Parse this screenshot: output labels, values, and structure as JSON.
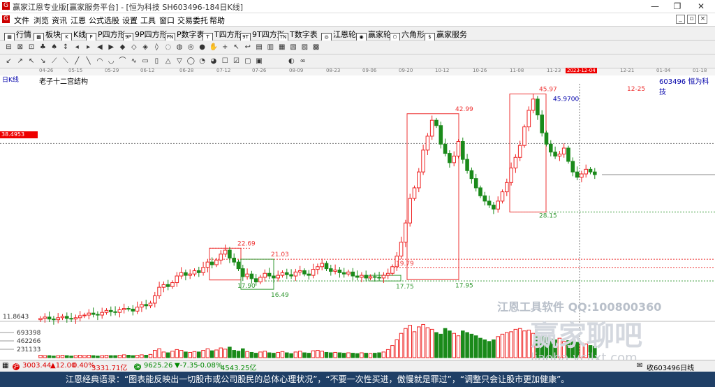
{
  "window": {
    "title": "赢家江恩专业版[赢家服务平台] - [恒为科技  SH603496-184日K线]",
    "min_glyph": "—",
    "max_glyph": "❐",
    "close_glyph": "✕"
  },
  "menu": [
    "文件",
    "浏览",
    "资讯",
    "江恩",
    "公式选股",
    "设置",
    "工具",
    "窗口",
    "交易委托",
    "帮助"
  ],
  "toolbar1": [
    {
      "label": "行情",
      "icon": "grid-icon",
      "glyph": "▦"
    },
    {
      "label": "板块",
      "icon": "sector-icon",
      "glyph": "▩"
    },
    {
      "label": "K线",
      "icon": "kline-icon",
      "glyph": "K"
    },
    {
      "label": "P四方形",
      "icon": "p-square-icon",
      "glyph": "P"
    },
    {
      "label": "9P四方形",
      "icon": "9p-square-icon",
      "glyph": "9P"
    },
    {
      "label": "P数字表",
      "icon": "p-number-icon",
      "glyph": "PN"
    },
    {
      "label": "T四方形",
      "icon": "t-square-icon",
      "glyph": "T"
    },
    {
      "label": "9T四方形",
      "icon": "9t-square-icon",
      "glyph": "9T"
    },
    {
      "label": "T数字表",
      "icon": "t-number-icon",
      "glyph": "TN"
    },
    {
      "label": "江恩轮",
      "icon": "gann-wheel-icon",
      "glyph": "◎"
    },
    {
      "label": "赢家轮",
      "icon": "winner-wheel-icon",
      "glyph": "◉"
    },
    {
      "label": "六角形",
      "icon": "hexagon-icon",
      "glyph": "⬡"
    },
    {
      "label": "赢家服务",
      "icon": "service-icon",
      "glyph": "$"
    }
  ],
  "toolbar2_icons": [
    "⊟",
    "⊠",
    "⊡",
    "♣",
    "♠",
    "↕",
    "◂",
    "▸",
    "◀",
    "▶",
    "◆",
    "◇",
    "◈",
    "◊",
    "◌",
    "◍",
    "◎",
    "●",
    "✋",
    "+",
    "↖",
    "↩",
    "▤",
    "▥",
    "▦",
    "▧",
    "▨",
    "▩"
  ],
  "toolbar3_icons": [
    "↙",
    "↗",
    "↖",
    "↘",
    "⟋",
    "⟍",
    "╱",
    "╲",
    "◠",
    "◡",
    "⌒",
    "∿",
    "▭",
    "▯",
    "△",
    "▽",
    "◯",
    "◔",
    "◕",
    "☐",
    "☑",
    "▢",
    "▣",
    "◐",
    "∞"
  ],
  "date_axis": {
    "labels": [
      "04-26",
      "05-15",
      "05-29",
      "06-12",
      "06-28",
      "07-12",
      "07-26",
      "08-09",
      "08-23",
      "09-06",
      "09-20",
      "10-12",
      "10-26",
      "11-08",
      "11-23",
      "2023-12-04",
      "12-21",
      "01-04",
      "01-18"
    ],
    "highlighted": "2023-12-04"
  },
  "info": {
    "period": "日K线",
    "study": "老子十二宫结构",
    "code_name": "603496  恒为科技",
    "cursor_price": "38.4953",
    "future_label": "12-25"
  },
  "chart_data": {
    "type": "candlestick",
    "title": "",
    "ylim": [
      11.8643,
      47.5
    ],
    "volume_ticks": [
      693398,
      462266,
      231133
    ],
    "price_axis_min_label": "11.8643",
    "annotations_price": [
      {
        "text": "22.69",
        "value": 22.69
      },
      {
        "text": "21.03",
        "value": 21.03
      },
      {
        "text": "19.79",
        "value": 19.79
      },
      {
        "text": "17.90",
        "value": 17.9
      },
      {
        "text": "16.49",
        "value": 16.49
      },
      {
        "text": "17.75",
        "value": 17.75
      },
      {
        "text": "17.95",
        "value": 17.95
      },
      {
        "text": "42.99",
        "value": 42.99
      },
      {
        "text": "45.97",
        "value": 45.97
      },
      {
        "text": "45.9700",
        "value": 45.97
      },
      {
        "text": "28.15",
        "value": 28.15
      }
    ],
    "closes": [
      12.1,
      12.3,
      12.0,
      11.9,
      12.2,
      12.4,
      12.1,
      12.0,
      12.2,
      12.5,
      12.6,
      12.9,
      12.7,
      12.6,
      13.0,
      13.3,
      13.1,
      13.0,
      13.4,
      13.6,
      13.5,
      13.2,
      13.8,
      14.2,
      14.0,
      14.4,
      15.5,
      16.8,
      17.2,
      16.9,
      17.5,
      18.5,
      19.0,
      18.6,
      18.8,
      19.3,
      19.0,
      19.8,
      20.6,
      20.2,
      20.9,
      21.8,
      22.4,
      21.2,
      20.6,
      19.6,
      18.4,
      18.8,
      18.1,
      17.6,
      18.3,
      18.9,
      18.5,
      18.2,
      18.6,
      19.0,
      18.7,
      18.5,
      19.1,
      19.3,
      18.8,
      18.6,
      19.5,
      19.9,
      20.4,
      19.6,
      19.2,
      19.4,
      19.0,
      18.8,
      19.1,
      18.5,
      18.3,
      18.6,
      18.2,
      18.4,
      18.3,
      18.2,
      18.6,
      18.9,
      19.9,
      21.5,
      23.6,
      26.5,
      30.2,
      31.8,
      34.2,
      37.5,
      39.6,
      42.0,
      41.2,
      38.4,
      37.0,
      35.6,
      36.6,
      38.8,
      36.1,
      34.4,
      33.2,
      31.8,
      30.6,
      29.8,
      29.2,
      28.6,
      29.8,
      31.2,
      32.6,
      34.8,
      36.4,
      38.2,
      41.0,
      43.5,
      45.2,
      42.8,
      40.1,
      38.4,
      37.2,
      36.6,
      36.9,
      37.8,
      35.8,
      34.2,
      33.4,
      33.9,
      34.6,
      34.2,
      33.8
    ],
    "volume_pct": [
      6,
      5,
      5,
      4,
      5,
      6,
      5,
      4,
      5,
      6,
      5,
      6,
      5,
      4,
      5,
      6,
      5,
      5,
      6,
      7,
      6,
      5,
      6,
      7,
      6,
      8,
      18,
      22,
      14,
      12,
      16,
      20,
      18,
      14,
      13,
      15,
      14,
      18,
      22,
      17,
      19,
      24,
      21,
      26,
      18,
      16,
      22,
      15,
      13,
      11,
      14,
      16,
      12,
      11,
      13,
      15,
      12,
      10,
      14,
      16,
      12,
      11,
      17,
      18,
      16,
      13,
      12,
      13,
      12,
      11,
      12,
      11,
      10,
      12,
      11,
      10,
      11,
      12,
      14,
      20,
      30,
      44,
      60,
      72,
      80,
      64,
      76,
      82,
      74,
      70,
      62,
      58,
      72,
      66,
      60,
      54,
      66,
      62,
      58,
      54,
      48,
      44,
      40,
      44,
      52,
      58,
      62,
      64,
      70,
      72,
      66,
      68,
      60,
      56,
      52,
      50,
      46,
      44,
      48,
      40,
      42,
      40,
      38,
      36,
      34,
      30,
      28
    ]
  },
  "watermark": {
    "line1": "江恩工具软件  QQ:100800360",
    "line2": "赢家聊吧",
    "line3": "liaoba.ycjlxt.com"
  },
  "status": {
    "sh_index": "3003.44",
    "sh_change": "▲12.00",
    "sh_pct": "0.40%",
    "sh_amount": "3331.71亿",
    "sz_index": "9625.26",
    "sz_change": "▼-7.35",
    "sz_pct": "-0.08%",
    "sz_amount": "4543.25亿",
    "right_label": "收603496日线"
  },
  "quote": "江恩经典语录：“图表能反映出一切股市或公司股民的总体心理状况”，“不要一次性买进，傲慢就是罪过”，“调整只会让股市更加健康”。"
}
